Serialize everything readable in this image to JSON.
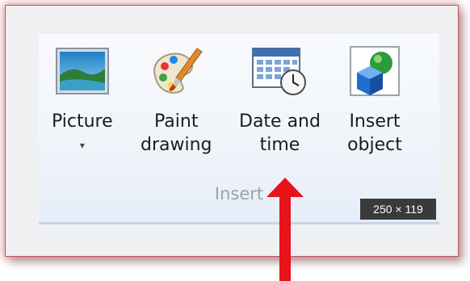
{
  "ribbon": {
    "group_label": "Insert",
    "commands": [
      {
        "line1": "Picture",
        "line2": "▾",
        "icon": "picture-icon"
      },
      {
        "line1": "Paint",
        "line2": "drawing",
        "icon": "paint-palette-icon"
      },
      {
        "line1": "Date and",
        "line2": "time",
        "icon": "calendar-clock-icon"
      },
      {
        "line1": "Insert",
        "line2": "object",
        "icon": "3d-object-icon"
      }
    ]
  },
  "overlay": {
    "dimensions": "250 × 119",
    "annotation_arrow_color": "#e8121b",
    "frame_border_color": "#b9545c"
  }
}
